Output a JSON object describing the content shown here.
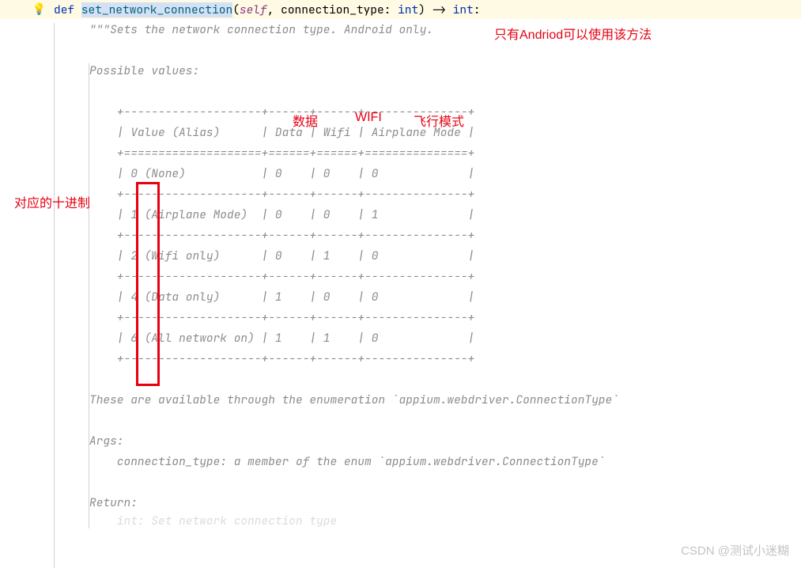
{
  "code": {
    "def": "def ",
    "function_name": "set_network_connection",
    "params_open": "(",
    "self": "self",
    "comma1": ", ",
    "param1": "connection_type",
    "colon1": ": ",
    "type1": "int",
    "params_close": ") -> ",
    "return_type": "int",
    "end_colon": ":"
  },
  "docstring": {
    "line1": "\"\"\"Sets the network connection type. Android only.",
    "blank1": "",
    "possible": "Possible values:",
    "blank2": "",
    "tborder_top": "    +--------------------+------+------+---------------+",
    "theader": "    | Value (Alias)      | Data | Wifi | Airplane Mode |",
    "theader_sep": "    +====================+======+======+===============+",
    "trow0": "    | 0 (None)           | 0    | 0    | 0             |",
    "tsep0": "    +--------------------+------+------+---------------+",
    "trow1": "    | 1 (Airplane Mode)  | 0    | 0    | 1             |",
    "tsep1": "    +--------------------+------+------+---------------+",
    "trow2": "    | 2 (Wifi only)      | 0    | 1    | 0             |",
    "tsep2": "    +--------------------+------+------+---------------+",
    "trow4": "    | 4 (Data only)      | 1    | 0    | 0             |",
    "tsep4": "    +--------------------+------+------+---------------+",
    "trow6": "    | 6 (All network on) | 1    | 1    | 0             |",
    "tborder_bot": "    +--------------------+------+------+---------------+",
    "blank3": "",
    "avail": "These are available through the enumeration `appium.webdriver.ConnectionType`",
    "blank4": "",
    "args": "Args:",
    "args_desc": "    connection_type: a member of the enum `appium.webdriver.ConnectionType`",
    "blank5": "",
    "return": "Return:",
    "return_desc": "    int: Set network connection type"
  },
  "annotations": {
    "android_only": "只有Andriod可以使用该方法",
    "data_col": "数据",
    "wifi_col": "WIFI",
    "airplane_col": "飞行模式",
    "decimal_label": "对应的十进制"
  },
  "watermark": "CSDN @测试小迷糊"
}
